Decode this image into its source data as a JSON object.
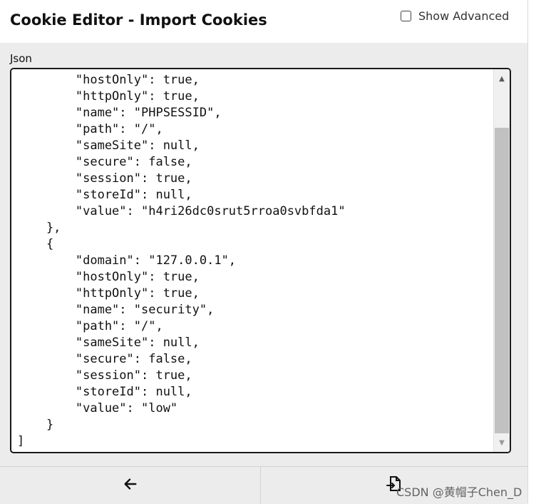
{
  "header": {
    "title": "Cookie Editor - Import Cookies",
    "show_advanced_label": "Show Advanced",
    "show_advanced_checked": false
  },
  "editor": {
    "label": "Json",
    "content": "        \"hostOnly\": true,\n        \"httpOnly\": true,\n        \"name\": \"PHPSESSID\",\n        \"path\": \"/\",\n        \"sameSite\": null,\n        \"secure\": false,\n        \"session\": true,\n        \"storeId\": null,\n        \"value\": \"h4ri26dc0srut5rroa0svbfda1\"\n    },\n    {\n        \"domain\": \"127.0.0.1\",\n        \"hostOnly\": true,\n        \"httpOnly\": true,\n        \"name\": \"security\",\n        \"path\": \"/\",\n        \"sameSite\": null,\n        \"secure\": false,\n        \"session\": true,\n        \"storeId\": null,\n        \"value\": \"low\"\n    }\n]"
  },
  "footer": {
    "back_icon": "arrow-left-icon",
    "import_icon": "file-import-icon"
  },
  "watermark": "CSDN @黄帽子Chen_D",
  "colors": {
    "panel_bg": "#ececec",
    "header_bg": "#ffffff",
    "editor_border": "#1a1a1a",
    "scroll_thumb": "#c1c1c1"
  }
}
